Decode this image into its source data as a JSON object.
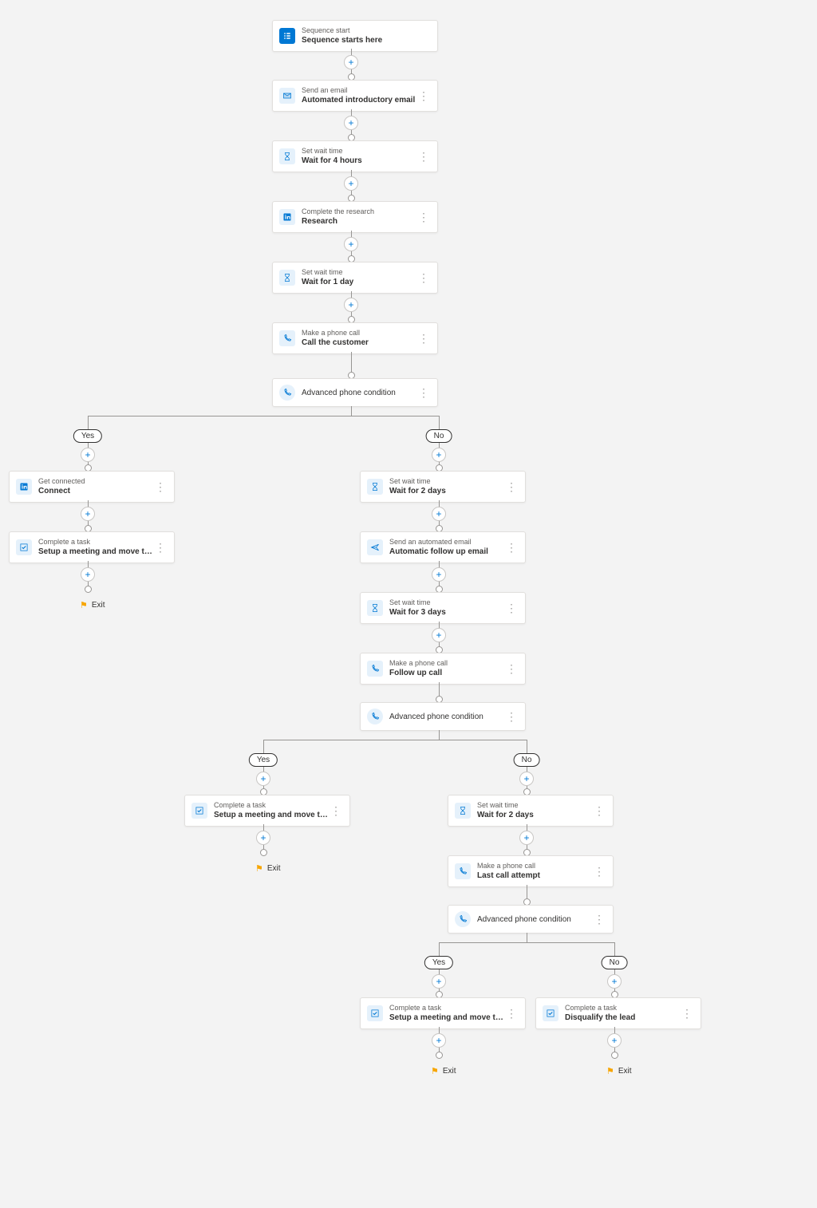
{
  "labels": {
    "exit": "Exit",
    "yes": "Yes",
    "no": "No"
  },
  "nodes": {
    "n0": {
      "t": "Sequence start",
      "s": "Sequence starts here"
    },
    "n1": {
      "t": "Send an email",
      "s": "Automated introductory email"
    },
    "n2": {
      "t": "Set wait time",
      "s": "Wait for 4 hours"
    },
    "n3": {
      "t": "Complete the research",
      "s": "Research"
    },
    "n4": {
      "t": "Set wait time",
      "s": "Wait for 1 day"
    },
    "n5": {
      "t": "Make a phone call",
      "s": "Call the customer"
    },
    "c1": {
      "s": "Advanced phone condition"
    },
    "y1a": {
      "t": "Get connected",
      "s": "Connect"
    },
    "y1b": {
      "t": "Complete a task",
      "s": "Setup a meeting and move to the next s…"
    },
    "na": {
      "t": "Set wait time",
      "s": "Wait for 2 days"
    },
    "nb": {
      "t": "Send an automated email",
      "s": "Automatic follow up email"
    },
    "nc": {
      "t": "Set wait time",
      "s": "Wait for 3 days"
    },
    "nd": {
      "t": "Make a phone call",
      "s": "Follow up call"
    },
    "c2": {
      "s": "Advanced phone condition"
    },
    "y2": {
      "t": "Complete a task",
      "s": "Setup a meeting and move to the next s…"
    },
    "n2a": {
      "t": "Set wait time",
      "s": "Wait for 2 days"
    },
    "n2b": {
      "t": "Make a phone call",
      "s": "Last call attempt"
    },
    "c3": {
      "s": "Advanced phone condition"
    },
    "y3": {
      "t": "Complete a task",
      "s": "Setup a meeting and move to the next s…"
    },
    "n3x": {
      "t": "Complete a task",
      "s": "Disqualify the lead"
    }
  }
}
